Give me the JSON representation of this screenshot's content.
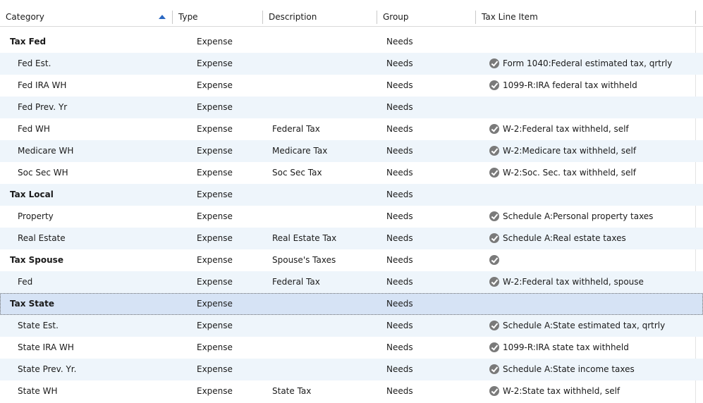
{
  "columns": {
    "category": "Category",
    "type": "Type",
    "description": "Description",
    "group": "Group",
    "tax_line_item": "Tax Line Item"
  },
  "rows": [
    {
      "category": "Tax Fed",
      "type": "Expense",
      "description": "",
      "group": "Needs",
      "tax_line": "",
      "has_check": false,
      "parent": true
    },
    {
      "category": "Fed Est.",
      "type": "Expense",
      "description": "",
      "group": "Needs",
      "tax_line": "Form 1040:Federal estimated tax, qrtrly",
      "has_check": true,
      "parent": false
    },
    {
      "category": "Fed IRA WH",
      "type": "Expense",
      "description": "",
      "group": "Needs",
      "tax_line": "1099-R:IRA federal tax withheld",
      "has_check": true,
      "parent": false
    },
    {
      "category": "Fed Prev. Yr",
      "type": "Expense",
      "description": "",
      "group": "Needs",
      "tax_line": "",
      "has_check": false,
      "parent": false
    },
    {
      "category": "Fed WH",
      "type": "Expense",
      "description": "Federal Tax",
      "group": "Needs",
      "tax_line": "W-2:Federal tax withheld, self",
      "has_check": true,
      "parent": false
    },
    {
      "category": "Medicare WH",
      "type": "Expense",
      "description": "Medicare Tax",
      "group": "Needs",
      "tax_line": "W-2:Medicare tax withheld, self",
      "has_check": true,
      "parent": false
    },
    {
      "category": "Soc Sec WH",
      "type": "Expense",
      "description": "Soc Sec Tax",
      "group": "Needs",
      "tax_line": "W-2:Soc. Sec. tax withheld, self",
      "has_check": true,
      "parent": false
    },
    {
      "category": "Tax Local",
      "type": "Expense",
      "description": "",
      "group": "Needs",
      "tax_line": "",
      "has_check": false,
      "parent": true
    },
    {
      "category": "Property",
      "type": "Expense",
      "description": "",
      "group": "Needs",
      "tax_line": "Schedule A:Personal property taxes",
      "has_check": true,
      "parent": false
    },
    {
      "category": "Real Estate",
      "type": "Expense",
      "description": "Real Estate Tax",
      "group": "Needs",
      "tax_line": "Schedule A:Real estate taxes",
      "has_check": true,
      "parent": false
    },
    {
      "category": "Tax Spouse",
      "type": "Expense",
      "description": "Spouse's Taxes",
      "group": "Needs",
      "tax_line": "",
      "has_check": true,
      "parent": true
    },
    {
      "category": "Fed",
      "type": "Expense",
      "description": "Federal Tax",
      "group": "Needs",
      "tax_line": "W-2:Federal tax withheld, spouse",
      "has_check": true,
      "parent": false
    },
    {
      "category": "Tax State",
      "type": "Expense",
      "description": "",
      "group": "Needs",
      "tax_line": "",
      "has_check": false,
      "parent": true,
      "selected": true
    },
    {
      "category": "State Est.",
      "type": "Expense",
      "description": "",
      "group": "Needs",
      "tax_line": "Schedule A:State estimated tax, qrtrly",
      "has_check": true,
      "parent": false
    },
    {
      "category": "State IRA WH",
      "type": "Expense",
      "description": "",
      "group": "Needs",
      "tax_line": "1099-R:IRA state tax withheld",
      "has_check": true,
      "parent": false
    },
    {
      "category": "State Prev. Yr.",
      "type": "Expense",
      "description": "",
      "group": "Needs",
      "tax_line": "Schedule A:State income taxes",
      "has_check": true,
      "parent": false
    },
    {
      "category": "State WH",
      "type": "Expense",
      "description": "State Tax",
      "group": "Needs",
      "tax_line": "W-2:State tax withheld, self",
      "has_check": true,
      "parent": false
    }
  ]
}
